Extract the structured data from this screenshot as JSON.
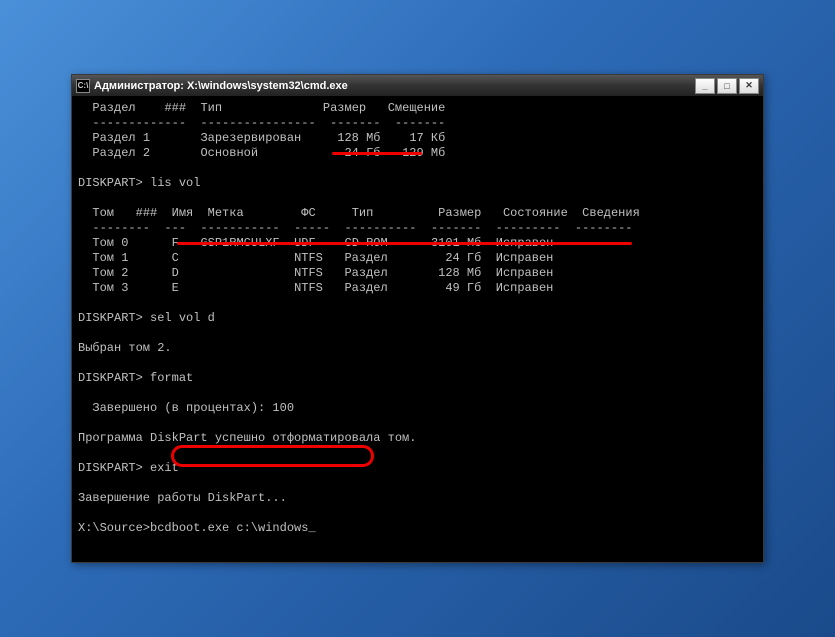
{
  "title": "Администратор: X:\\windows\\system32\\cmd.exe",
  "headers1": {
    "col1": "Раздел",
    "col2": "###",
    "col3": "Тип",
    "col4": "Размер",
    "col5": "Смещение"
  },
  "partitions": [
    {
      "name": "Раздел 1",
      "type": "Зарезервирован",
      "size": "128 Мб",
      "offset": "17 Кб"
    },
    {
      "name": "Раздел 2",
      "type": "Основной",
      "size": "24 Гб",
      "offset": "129 Мб"
    }
  ],
  "prompt1": "DISKPART> lis vol",
  "headers2": {
    "c1": "Том",
    "c2": "###",
    "c3": "Имя",
    "c4": "Метка",
    "c5": "ФС",
    "c6": "Тип",
    "c7": "Размер",
    "c8": "Состояние",
    "c9": "Сведения"
  },
  "volumes": [
    {
      "name": "Том 0",
      "letter": "F",
      "label": "GSP1RMCULXF",
      "fs": "UDF",
      "type": "CD-ROM",
      "size": "3101 Мб",
      "state": "Исправен"
    },
    {
      "name": "Том 1",
      "letter": "C",
      "label": "",
      "fs": "NTFS",
      "type": "Раздел",
      "size": "24 Гб",
      "state": "Исправен"
    },
    {
      "name": "Том 2",
      "letter": "D",
      "label": "",
      "fs": "NTFS",
      "type": "Раздел",
      "size": "128 Мб",
      "state": "Исправен"
    },
    {
      "name": "Том 3",
      "letter": "E",
      "label": "",
      "fs": "NTFS",
      "type": "Раздел",
      "size": "49 Гб",
      "state": "Исправен"
    }
  ],
  "prompt2": "DISKPART> sel vol d",
  "selected": "Выбран том 2.",
  "prompt3": "DISKPART> format",
  "progress": "  Завершено (в процентах): 100",
  "formatted": "Программа DiskPart успешно отформатировала том.",
  "prompt4": "DISKPART> exit",
  "exiting": "Завершение работы DiskPart...",
  "finalPrompt": "X:\\Source>",
  "finalCmd": "bcdboot.exe c:\\windows",
  "cursor": "_",
  "winBtns": {
    "min": "_",
    "max": "□",
    "close": "✕"
  }
}
